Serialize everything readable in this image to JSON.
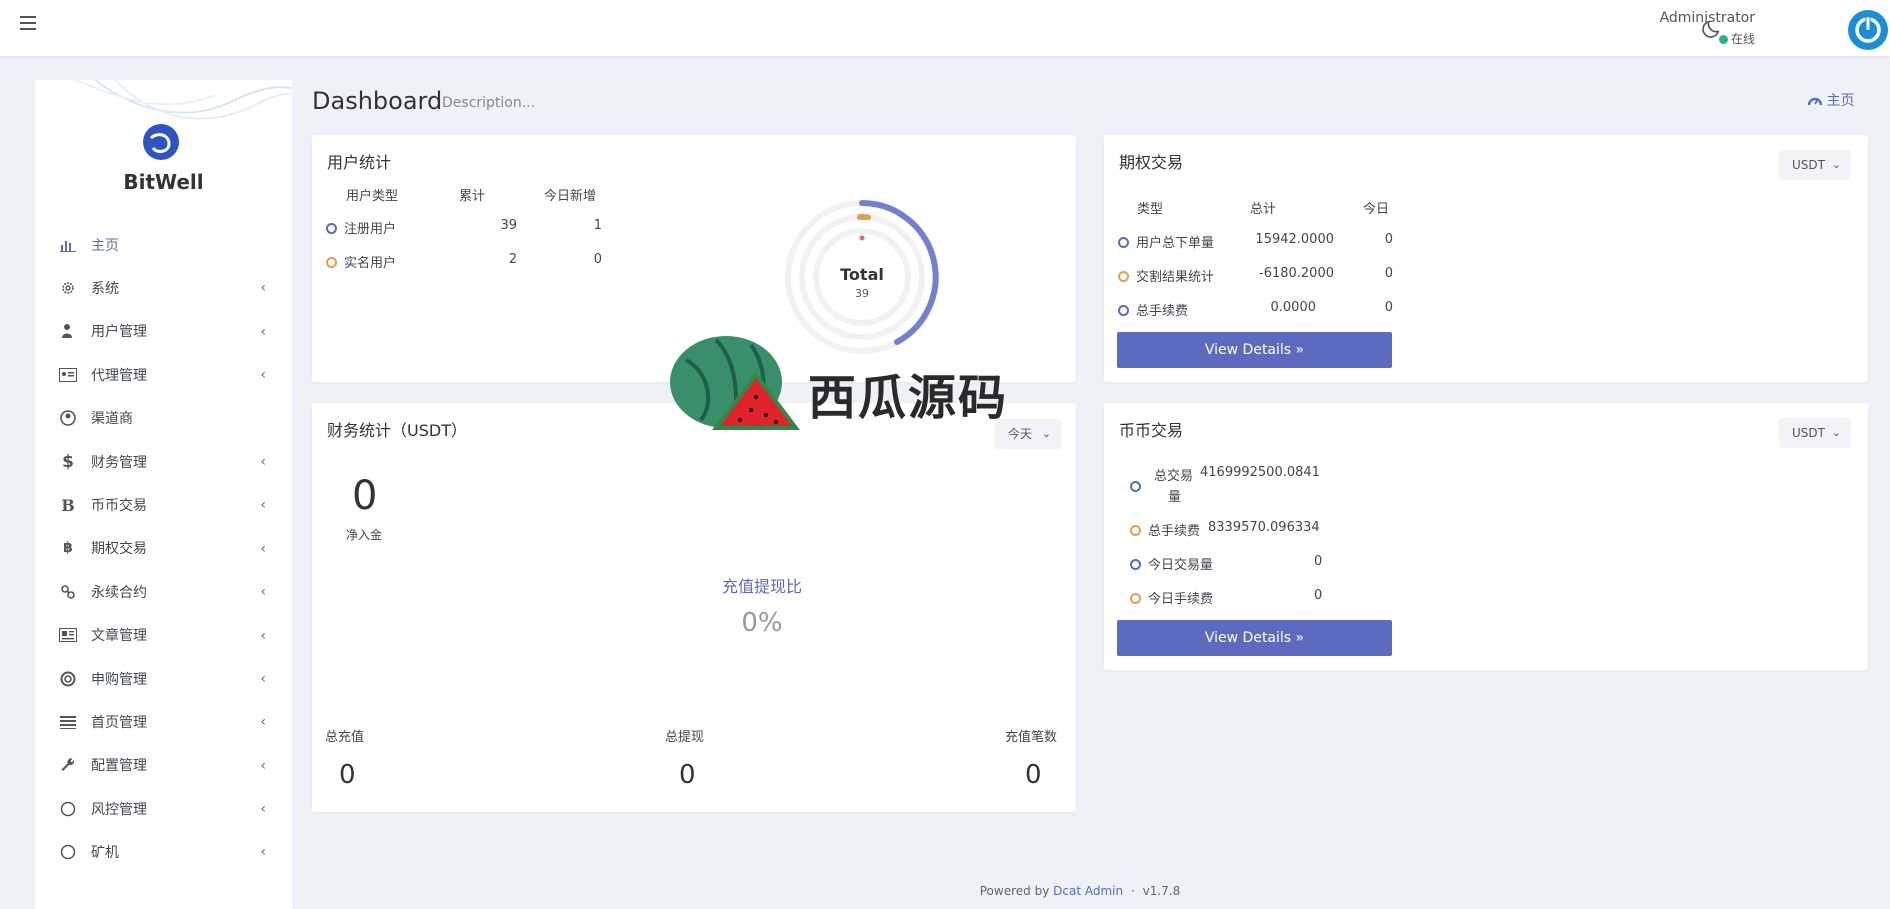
{
  "topbar": {
    "user_name": "Administrator",
    "user_status": "在线"
  },
  "sidebar": {
    "brand": "BitWell",
    "items": [
      {
        "label": "主页",
        "icon": "bar-chart-icon",
        "active": true,
        "has_children": false
      },
      {
        "label": "系统",
        "icon": "gear-icon",
        "active": false,
        "has_children": true
      },
      {
        "label": "用户管理",
        "icon": "users-icon",
        "active": false,
        "has_children": true
      },
      {
        "label": "代理管理",
        "icon": "id-card-icon",
        "active": false,
        "has_children": true
      },
      {
        "label": "渠道商",
        "icon": "user-circle-icon",
        "active": false,
        "has_children": false
      },
      {
        "label": "财务管理",
        "icon": "dollar-icon",
        "active": false,
        "has_children": true
      },
      {
        "label": "币币交易",
        "icon": "letter-b-icon",
        "active": false,
        "has_children": true
      },
      {
        "label": "期权交易",
        "icon": "bitcoin-icon",
        "active": false,
        "has_children": true
      },
      {
        "label": "永续合约",
        "icon": "link-icon",
        "active": false,
        "has_children": true
      },
      {
        "label": "文章管理",
        "icon": "newspaper-icon",
        "active": false,
        "has_children": true
      },
      {
        "label": "申购管理",
        "icon": "lifebuoy-icon",
        "active": false,
        "has_children": true
      },
      {
        "label": "首页管理",
        "icon": "list-icon",
        "active": false,
        "has_children": true
      },
      {
        "label": "配置管理",
        "icon": "wrench-icon",
        "active": false,
        "has_children": true
      },
      {
        "label": "风控管理",
        "icon": "circle-icon",
        "active": false,
        "has_children": true
      },
      {
        "label": "矿机",
        "icon": "circle-icon",
        "active": false,
        "has_children": true
      }
    ]
  },
  "header": {
    "title": "Dashboard",
    "description": "Description...",
    "breadcrumb": "主页"
  },
  "user_stats": {
    "title": "用户统计",
    "columns": [
      "用户类型",
      "累计",
      "今日新增"
    ],
    "rows": [
      {
        "type": "注册用户",
        "total": "39",
        "today": "1",
        "color": "blue"
      },
      {
        "type": "实名用户",
        "total": "2",
        "today": "0",
        "color": "orange"
      }
    ],
    "donut_label": "Total",
    "donut_value": "39"
  },
  "options": {
    "title": "期权交易",
    "currency": "USDT",
    "columns": [
      "类型",
      "总计",
      "今日"
    ],
    "rows": [
      {
        "type": "用户总下单量",
        "total": "15942.0000",
        "today": "0",
        "color": "blue"
      },
      {
        "type": "交割结果统计",
        "total": "-6180.2000",
        "today": "0",
        "color": "orange"
      },
      {
        "type": "总手续费",
        "total": "0.0000",
        "today": "0",
        "color": "blue"
      }
    ],
    "button": "View Details »"
  },
  "finance": {
    "title": "财务统计（USDT）",
    "period": "今天",
    "net_value": "0",
    "net_label": "净入金",
    "ratio_label": "充值提现比",
    "ratio_value": "0%",
    "stats": [
      {
        "label": "总充值",
        "value": "0"
      },
      {
        "label": "总提现",
        "value": "0"
      },
      {
        "label": "充值笔数",
        "value": "0"
      }
    ]
  },
  "spot": {
    "title": "币币交易",
    "currency": "USDT",
    "rows": [
      {
        "label": "总交易量",
        "label_line1": "总交易",
        "label_line2": "量",
        "value": "4169992500.0841",
        "color": "blue"
      },
      {
        "label": "总手续费",
        "value": "8339570.096334",
        "color": "orange"
      },
      {
        "label": "今日交易量",
        "value": "0",
        "color": "blue"
      },
      {
        "label": "今日手续费",
        "value": "0",
        "color": "orange"
      }
    ],
    "button": "View Details »"
  },
  "watermark": {
    "text": "西瓜源码"
  },
  "footer": {
    "powered": "Powered by",
    "link": "Dcat Admin",
    "sep": "·",
    "version": "v1.7.8"
  },
  "colors": {
    "accent": "#5c6bc0",
    "orange": "#e2a054",
    "online": "#21b978"
  }
}
